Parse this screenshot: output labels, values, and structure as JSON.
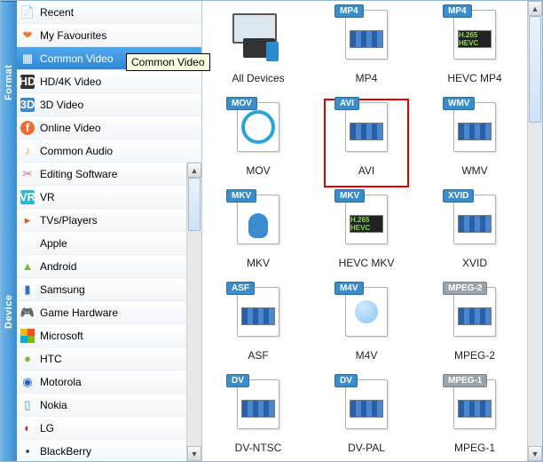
{
  "tooltip": "Common Video",
  "format_tab": "Format",
  "device_tab": "Device",
  "format_items": [
    {
      "label": "Recent",
      "icon": "📄",
      "cls": "ic-recent",
      "name": "sidebar-item-recent"
    },
    {
      "label": "My Favourites",
      "icon": "❤",
      "cls": "ic-heart",
      "name": "sidebar-item-favourites"
    },
    {
      "label": "Common Video",
      "icon": "▦",
      "cls": "ic-common",
      "name": "sidebar-item-common-video",
      "selected": true
    },
    {
      "label": "HD/4K Video",
      "icon": "HD",
      "cls": "ic-hd",
      "name": "sidebar-item-hd-4k"
    },
    {
      "label": "3D Video",
      "icon": "3D",
      "cls": "ic-3d",
      "name": "sidebar-item-3d-video"
    },
    {
      "label": "Online Video",
      "icon": "f",
      "cls": "ic-online",
      "name": "sidebar-item-online-video"
    },
    {
      "label": "Common Audio",
      "icon": "♪",
      "cls": "ic-audio",
      "name": "sidebar-item-common-audio"
    }
  ],
  "device_items": [
    {
      "label": "Editing Software",
      "icon": "✂",
      "cls": "ic-edit",
      "name": "sidebar-item-editing-software"
    },
    {
      "label": "VR",
      "icon": "VR",
      "cls": "ic-vr",
      "name": "sidebar-item-vr"
    },
    {
      "label": "TVs/Players",
      "icon": "▸",
      "cls": "ic-tv",
      "name": "sidebar-item-tvs-players"
    },
    {
      "label": "Apple",
      "icon": "",
      "cls": "ic-apple",
      "name": "sidebar-item-apple"
    },
    {
      "label": "Android",
      "icon": "▲",
      "cls": "ic-android",
      "name": "sidebar-item-android"
    },
    {
      "label": "Samsung",
      "icon": "▮",
      "cls": "ic-samsung",
      "name": "sidebar-item-samsung"
    },
    {
      "label": "Game Hardware",
      "icon": "🎮",
      "cls": "ic-game",
      "name": "sidebar-item-game-hardware"
    },
    {
      "label": "Microsoft",
      "icon": "",
      "cls": "ic-ms",
      "name": "sidebar-item-microsoft"
    },
    {
      "label": "HTC",
      "icon": "●",
      "cls": "ic-htc",
      "name": "sidebar-item-htc"
    },
    {
      "label": "Motorola",
      "icon": "◉",
      "cls": "ic-moto",
      "name": "sidebar-item-motorola"
    },
    {
      "label": "Nokia",
      "icon": "▯",
      "cls": "ic-nokia",
      "name": "sidebar-item-nokia"
    },
    {
      "label": "LG",
      "icon": "◐",
      "cls": "ic-lg",
      "name": "sidebar-item-lg"
    },
    {
      "label": "BlackBerry",
      "icon": "▪",
      "cls": "ic-bb",
      "name": "sidebar-item-blackberry"
    }
  ],
  "formats": [
    {
      "caption": "All Devices",
      "badge": "",
      "type": "devices",
      "name": "format-all-devices"
    },
    {
      "caption": "MP4",
      "badge": "MP4",
      "type": "file",
      "name": "format-mp4"
    },
    {
      "caption": "HEVC MP4",
      "badge": "MP4",
      "type": "dark",
      "darktext": "H.265 HEVC",
      "name": "format-hevc-mp4"
    },
    {
      "caption": "MOV",
      "badge": "MOV",
      "type": "qt",
      "name": "format-mov"
    },
    {
      "caption": "AVI",
      "badge": "AVI",
      "type": "file",
      "highlight": true,
      "name": "format-avi"
    },
    {
      "caption": "WMV",
      "badge": "WMV",
      "type": "file",
      "name": "format-wmv"
    },
    {
      "caption": "MKV",
      "badge": "MKV",
      "type": "mkv",
      "name": "format-mkv"
    },
    {
      "caption": "HEVC MKV",
      "badge": "MKV",
      "type": "dark",
      "darktext": "H.265 HEVC",
      "name": "format-hevc-mkv"
    },
    {
      "caption": "XVID",
      "badge": "XVID",
      "type": "file",
      "name": "format-xvid"
    },
    {
      "caption": "ASF",
      "badge": "ASF",
      "type": "file",
      "name": "format-asf"
    },
    {
      "caption": "M4V",
      "badge": "M4V",
      "type": "m4v",
      "name": "format-m4v"
    },
    {
      "caption": "MPEG-2",
      "badge": "MPEG-2",
      "badgecls": "gray",
      "type": "file",
      "name": "format-mpeg2"
    },
    {
      "caption": "DV-NTSC",
      "badge": "DV",
      "type": "file",
      "name": "format-dv-ntsc"
    },
    {
      "caption": "DV-PAL",
      "badge": "DV",
      "type": "file",
      "name": "format-dv-pal"
    },
    {
      "caption": "MPEG-1",
      "badge": "MPEG-1",
      "badgecls": "gray",
      "type": "file",
      "name": "format-mpeg1"
    }
  ]
}
